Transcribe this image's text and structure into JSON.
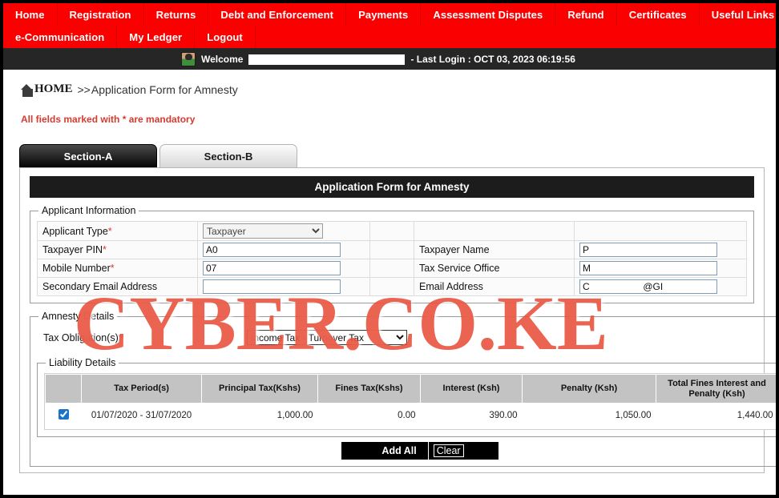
{
  "nav": {
    "row1": [
      {
        "label": "Home"
      },
      {
        "label": "Registration"
      },
      {
        "label": "Returns"
      },
      {
        "label": "Debt and Enforcement"
      },
      {
        "label": "Payments"
      },
      {
        "label": "Assessment Disputes"
      },
      {
        "label": "Refund"
      },
      {
        "label": "Certificates"
      },
      {
        "label": "Useful Links"
      }
    ],
    "row2": [
      {
        "label": "e-Communication"
      },
      {
        "label": "My Ledger"
      },
      {
        "label": "Logout"
      }
    ]
  },
  "welcome": {
    "avatar_icon": "user-avatar-icon",
    "label": "Welcome",
    "user_name": "",
    "last_login": "- Last Login : OCT 03, 2023 06:19:56"
  },
  "breadcrumb": {
    "home_icon": "home-icon",
    "home": "HOME",
    "separator": ">>",
    "current": "Application Form for Amnesty"
  },
  "notice": "All fields marked with * are mandatory",
  "tabs": [
    {
      "label": "Section-A",
      "active": true
    },
    {
      "label": "Section-B",
      "active": false
    }
  ],
  "form": {
    "title": "Application Form for Amnesty",
    "applicant_information": {
      "legend": "Applicant Information",
      "left": [
        {
          "label": "Applicant Type",
          "required": true,
          "type": "select",
          "value": "Taxpayer"
        },
        {
          "label": "Taxpayer PIN",
          "required": true,
          "type": "text",
          "value": "A0"
        },
        {
          "label": "Mobile Number",
          "required": true,
          "type": "text",
          "value": "07"
        },
        {
          "label": "Secondary Email Address",
          "required": false,
          "type": "text",
          "value": ""
        }
      ],
      "right": [
        {
          "label": "Taxpayer Name",
          "required": false,
          "type": "text",
          "value": "P"
        },
        {
          "label": "Tax Service Office",
          "required": false,
          "type": "text",
          "value": "M"
        },
        {
          "label": "Email Address",
          "required": false,
          "type": "text",
          "value": "C                    @GI"
        }
      ]
    },
    "amnesty_details": {
      "legend": "Amnesty Details",
      "obligation_label": "Tax Obligation(s)",
      "obligation_required": true,
      "obligation_value": "Income Tax - Turnover Tax"
    },
    "liability_details": {
      "legend": "Liability Details",
      "columns": [
        "",
        "Tax Period(s)",
        "Principal Tax(Kshs)",
        "Fines Tax(Kshs)",
        "Interest (Ksh)",
        "Penalty (Ksh)",
        "Total Fines Interest and Penalty (Ksh)",
        ""
      ],
      "rows": [
        {
          "selected": true,
          "period": "01/07/2020 - 31/07/2020",
          "principal_tax": "1,000.00",
          "fines_tax": "0.00",
          "interest": "390.00",
          "penalty": "1,050.00",
          "total_fines_interest_penalty": "1,440.00"
        }
      ]
    },
    "buttons": {
      "add_all": "Add All",
      "clear": "Clear"
    }
  },
  "watermark": "CYBER.CO.KE",
  "colors": {
    "nav_red": "#fb0000",
    "header_dark": "#1c1c1c",
    "notice_red": "#d83a2e",
    "watermark_red": "#e84e3a",
    "checkbox_blue": "#1a73c8"
  }
}
